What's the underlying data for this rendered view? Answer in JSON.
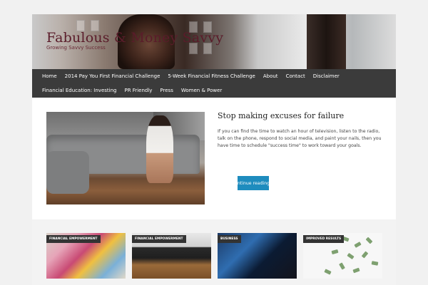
{
  "site": {
    "title": "Fabulous & Money Savvy",
    "tagline": "Growing Savvy Success"
  },
  "nav": {
    "row1": [
      "Home",
      "2014 Pay You First Financial Challenge",
      "5-Week Financial Fitness Challenge",
      "About",
      "Contact",
      "Disclaimer"
    ],
    "row2": [
      "Financial Education: Investing",
      "PR Friendly",
      "Press",
      "Women & Power"
    ]
  },
  "featured_post": {
    "title": "Stop making excuses for failure",
    "excerpt": "If you can find the time to watch an hour of television, listen to the radio, talk on the phone, respond to social media, and paint your nails, then you have time to schedule \"success time\" to work toward your goals.",
    "continue_label": "Continue reading →"
  },
  "cards": [
    {
      "category": "Financial Empowerment"
    },
    {
      "category": "Financial Empowerment"
    },
    {
      "category": "Business"
    },
    {
      "category": "Improved Results"
    }
  ],
  "colors": {
    "nav_bg": "#3b3b3b",
    "button_blue": "#1e8cbe",
    "title_color": "#5a1c2a"
  }
}
